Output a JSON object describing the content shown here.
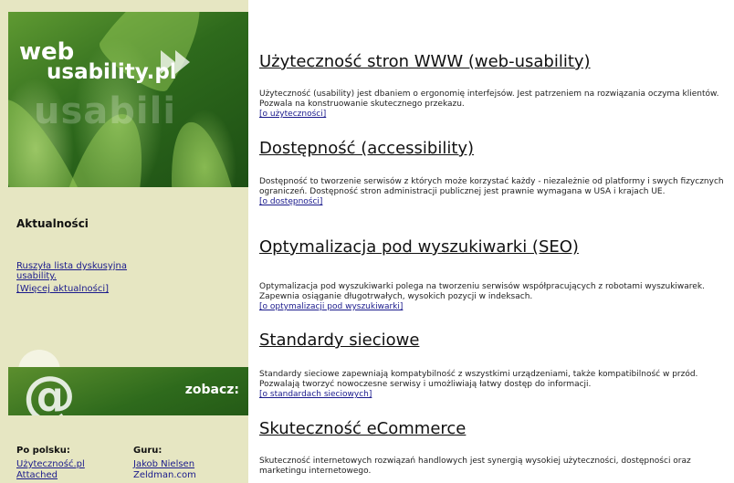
{
  "logo": {
    "web": "web",
    "domain": "usability.pl",
    "ghost": "usabili"
  },
  "sidebar": {
    "news_title": "Aktualności",
    "news_link_1": "Ruszyła lista dyskusyjna usability.",
    "news_link_2": "[Więcej aktualności]",
    "see_label": "zobacz:",
    "polish_title": "Po polsku:",
    "guru_title": "Guru:",
    "polish_links": [
      "Użyteczność.pl",
      "Attached"
    ],
    "guru_links": [
      "Jakob Nielsen",
      "Zeldman.com"
    ]
  },
  "sections": [
    {
      "title": "Użyteczność stron WWW (web-usability)",
      "text": "Użyteczność (usability) jest dbaniem o ergonomię interfejsów. Jest patrzeniem na rozwiązania oczyma klientów. Pozwala na konstruowanie skutecznego przekazu.",
      "link": "[o użyteczności]"
    },
    {
      "title": "Dostępność (accessibility)",
      "text": "Dostępność to tworzenie serwisów z których może korzystać każdy - niezależnie od platformy i swych fizycznych ograniczeń. Dostępność stron administracji publicznej jest prawnie wymagana w USA i krajach UE.",
      "link": "[o dostępności]"
    },
    {
      "title": "Optymalizacja pod wyszukiwarki (SEO)",
      "text": "Optymalizacja pod wyszukiwarki polega na tworzeniu serwisów współpracujących z robotami wyszukiwarek. Zapewnia osiąganie długotrwałych, wysokich pozycji w indeksach.",
      "link": "[o optymalizacji pod wyszukiwarki]"
    },
    {
      "title": "Standardy sieciowe",
      "text": "Standardy sieciowe zapewniają kompatybilność z wszystkimi urządzeniami, także kompatibilność w przód. Pozwalają tworzyć nowoczesne serwisy i umożliwiają łatwy dostęp do informacji.",
      "link": "[o standardach sieciowych]"
    },
    {
      "title": "Skuteczność eCommerce",
      "text": "Skuteczność internetowych rozwiązań handlowych jest synergią wysokiej użyteczności, dostępności oraz marketingu internetowego.",
      "link": ""
    }
  ]
}
